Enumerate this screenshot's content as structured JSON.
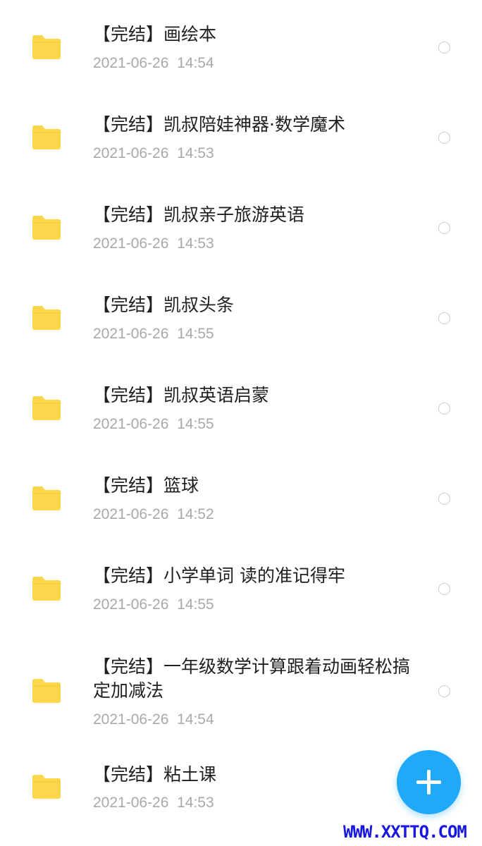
{
  "colors": {
    "folder": "#FDD74B",
    "title_text": "#1F1F1F",
    "date_text": "#A9A9A9",
    "radio_border": "#CFCFCF",
    "fab": "#1FA9F8",
    "watermark": "#1818E0"
  },
  "files": [
    {
      "icon": "folder-icon",
      "name": "【完结】画绘本",
      "date": "2021-06-26  14:54"
    },
    {
      "icon": "folder-icon",
      "name": "【完结】凯叔陪娃神器·数学魔术",
      "date": "2021-06-26  14:53"
    },
    {
      "icon": "folder-icon",
      "name": "【完结】凯叔亲子旅游英语",
      "date": "2021-06-26  14:53"
    },
    {
      "icon": "folder-icon",
      "name": "【完结】凯叔头条",
      "date": "2021-06-26  14:55"
    },
    {
      "icon": "folder-icon",
      "name": "【完结】凯叔英语启蒙",
      "date": "2021-06-26  14:55"
    },
    {
      "icon": "folder-icon",
      "name": "【完结】篮球",
      "date": "2021-06-26  14:52"
    },
    {
      "icon": "folder-icon",
      "name": "【完结】小学单词 读的准记得牢",
      "date": "2021-06-26  14:55"
    },
    {
      "icon": "folder-icon",
      "name": "【完结】一年级数学计算跟着动画轻松搞定加减法",
      "date": "2021-06-26  14:54"
    },
    {
      "icon": "folder-icon",
      "name": "【完结】粘土课",
      "date": "2021-06-26  14:53"
    }
  ],
  "fab": {
    "icon": "plus-icon"
  },
  "watermark": "WWW.XXTTQ.COM"
}
